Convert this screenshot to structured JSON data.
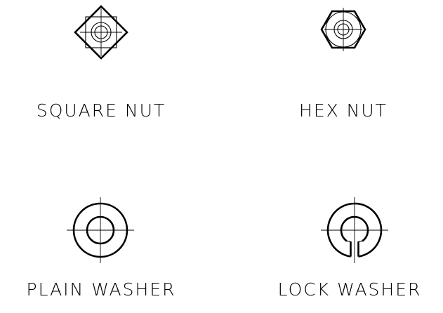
{
  "colors": {
    "background": "#ffffff",
    "ink": "#000000"
  },
  "parts": [
    {
      "name": "square-nut",
      "label": "SQUARE NUT",
      "icon": "square-nut-icon"
    },
    {
      "name": "hex-nut",
      "label": "HEX NUT",
      "icon": "hex-nut-icon"
    },
    {
      "name": "plain-washer",
      "label": "PLAIN WASHER",
      "icon": "plain-washer-icon"
    },
    {
      "name": "lock-washer",
      "label": "LOCK WASHER",
      "icon": "lock-washer-icon"
    }
  ]
}
